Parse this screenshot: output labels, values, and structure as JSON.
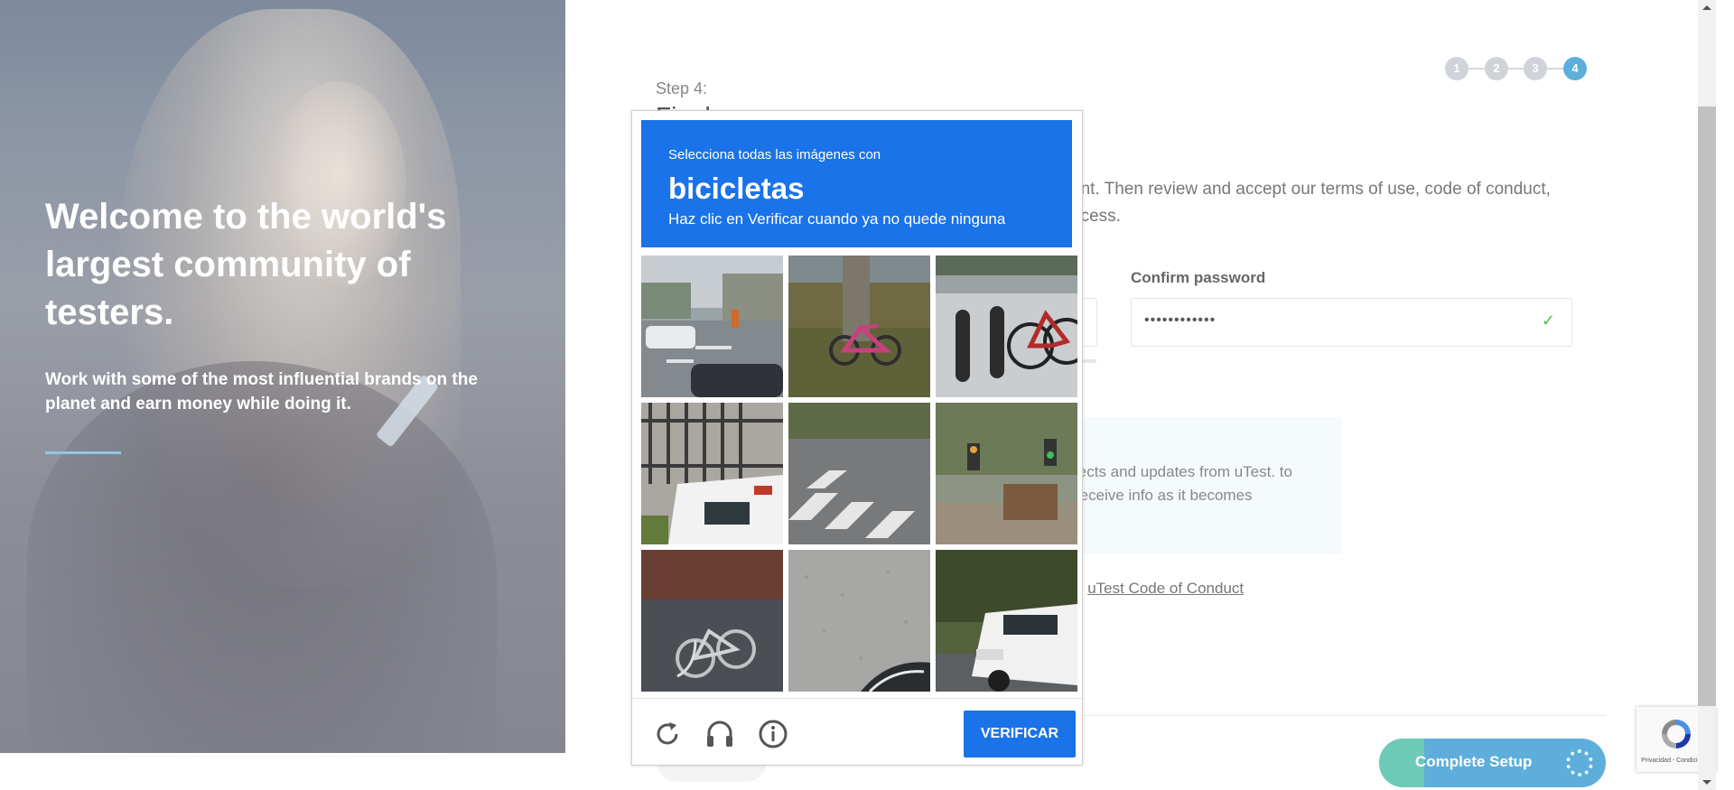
{
  "hero": {
    "title": "Welcome to the world's largest community of testers.",
    "subtitle": "Work with some of the most influential brands on the planet and earn money while doing it."
  },
  "steps": {
    "labels": [
      "1",
      "2",
      "3",
      "4"
    ],
    "active": "4"
  },
  "form": {
    "step_label": "Step 4:",
    "step_title": "Final",
    "instructions_line1": "unt. Then review and accept our terms of use, code of conduct,",
    "instructions_line2": "ocess.",
    "confirm_password_label": "Confirm password",
    "confirm_password_value": "••••••••••••",
    "optin_text": "jects and updates from uTest. to receive info as it becomes",
    "conduct_prefix": "e ",
    "conduct_link": "uTest Code of Conduct",
    "complete_button": "Complete Setup",
    "complete_progress": 0.2
  },
  "captcha": {
    "prompt_line1": "Selecciona todas las imágenes con",
    "prompt_object": "bicicletas",
    "prompt_line2": "Haz clic en Verificar cuando ya no quede ninguna",
    "verify_button": "VERIFICAR",
    "icons": [
      "reload-icon",
      "audio-icon",
      "info-icon"
    ]
  },
  "recaptcha_badge": {
    "text": "Privacidad - Condiciones"
  },
  "colors": {
    "accent_blue": "#1a73e8",
    "step_active": "#5eaedb",
    "complete_fill": "#6dcab6",
    "check_green": "#5cb85c"
  }
}
